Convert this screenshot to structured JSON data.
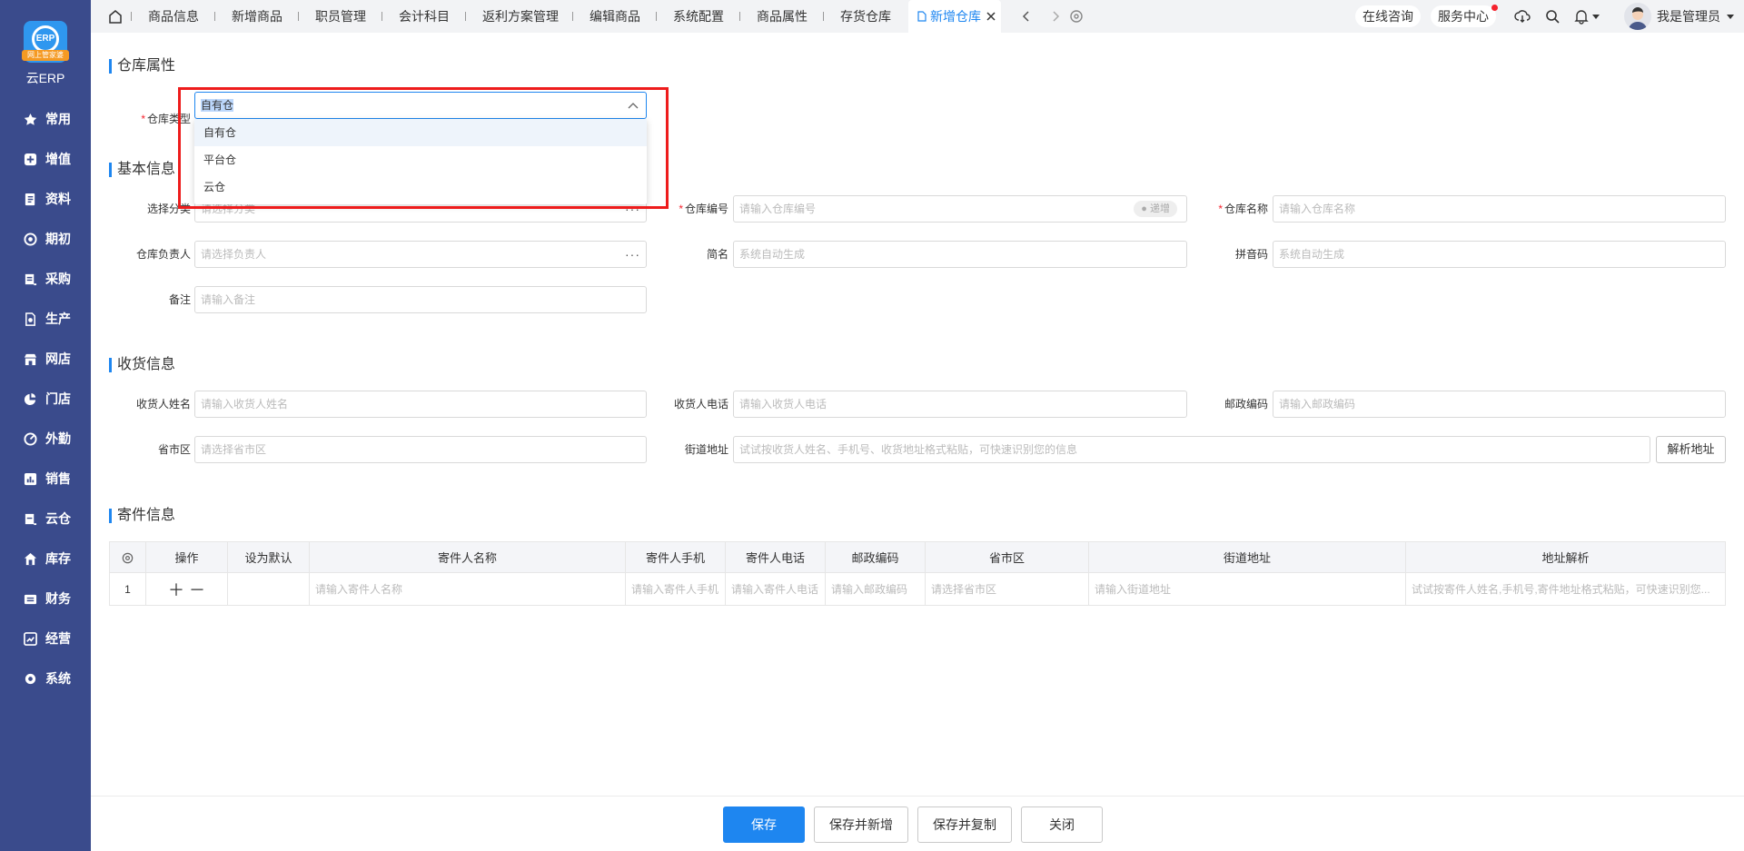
{
  "sidebar": {
    "logo_badge": "网上管家婆",
    "logo_text": "云ERP",
    "items": [
      {
        "label": "常用",
        "icon": "star-icon"
      },
      {
        "label": "增值",
        "icon": "plus-square-icon"
      },
      {
        "label": "资料",
        "icon": "document-icon"
      },
      {
        "label": "期初",
        "icon": "target-icon"
      },
      {
        "label": "采购",
        "icon": "purchase-icon"
      },
      {
        "label": "生产",
        "icon": "production-icon"
      },
      {
        "label": "网店",
        "icon": "store-icon"
      },
      {
        "label": "门店",
        "icon": "pie-icon"
      },
      {
        "label": "外勤",
        "icon": "field-icon"
      },
      {
        "label": "销售",
        "icon": "sales-icon"
      },
      {
        "label": "云仓",
        "icon": "cloud-warehouse-icon"
      },
      {
        "label": "库存",
        "icon": "home-icon"
      },
      {
        "label": "财务",
        "icon": "wallet-icon"
      },
      {
        "label": "经营",
        "icon": "chart-icon"
      },
      {
        "label": "系统",
        "icon": "gear-icon"
      }
    ]
  },
  "tabs": [
    {
      "label": "商品信息"
    },
    {
      "label": "新增商品"
    },
    {
      "label": "职员管理"
    },
    {
      "label": "会计科目"
    },
    {
      "label": "返利方案管理"
    },
    {
      "label": "编辑商品"
    },
    {
      "label": "系统配置"
    },
    {
      "label": "商品属性"
    },
    {
      "label": "存货仓库"
    },
    {
      "label": "新增仓库",
      "active": true
    }
  ],
  "header": {
    "online_consult": "在线咨询",
    "service_center": "服务中心",
    "user_name": "我是管理员"
  },
  "warehouse_attr": {
    "title": "仓库属性",
    "type_label": "仓库类型",
    "type_value": "自有仓",
    "options": [
      "自有仓",
      "平台仓",
      "云仓"
    ]
  },
  "basic": {
    "title": "基本信息",
    "category_label": "选择分类",
    "category_placeholder": "请选择分类",
    "code_label": "仓库编号",
    "code_placeholder": "请输入仓库编号",
    "code_badge": "递增",
    "name_label": "仓库名称",
    "name_placeholder": "请输入仓库名称",
    "manager_label": "仓库负责人",
    "manager_placeholder": "请选择负责人",
    "short_label": "简名",
    "short_placeholder": "系统自动生成",
    "pinyin_label": "拼音码",
    "pinyin_placeholder": "系统自动生成",
    "remark_label": "备注",
    "remark_placeholder": "请输入备注"
  },
  "receiving": {
    "title": "收货信息",
    "name_label": "收货人姓名",
    "name_placeholder": "请输入收货人姓名",
    "phone_label": "收货人电话",
    "phone_placeholder": "请输入收货人电话",
    "zip_label": "邮政编码",
    "zip_placeholder": "请输入邮政编码",
    "region_label": "省市区",
    "region_placeholder": "请选择省市区",
    "street_label": "街道地址",
    "street_placeholder": "试试按收货人姓名、手机号、收货地址格式粘贴，可快速识别您的信息",
    "parse_button": "解析地址"
  },
  "sender": {
    "title": "寄件信息",
    "columns": [
      "操作",
      "设为默认",
      "寄件人名称",
      "寄件人手机",
      "寄件人电话",
      "邮政编码",
      "省市区",
      "街道地址",
      "地址解析"
    ],
    "row": {
      "index": "1",
      "name": "请输入寄件人名称",
      "mobile": "请输入寄件人手机",
      "phone": "请输入寄件人电话",
      "zip": "请输入邮政编码",
      "region": "请选择省市区",
      "street": "请输入街道地址",
      "parse": "试试按寄件人姓名,手机号,寄件地址格式粘贴，可快速识别您..."
    }
  },
  "footer": {
    "save": "保存",
    "save_new": "保存并新增",
    "save_copy": "保存并复制",
    "close": "关闭"
  },
  "colors": {
    "sidebar": "#3a4b8c",
    "accent": "#1e86f0",
    "highlight_box": "#ee1c1c"
  }
}
